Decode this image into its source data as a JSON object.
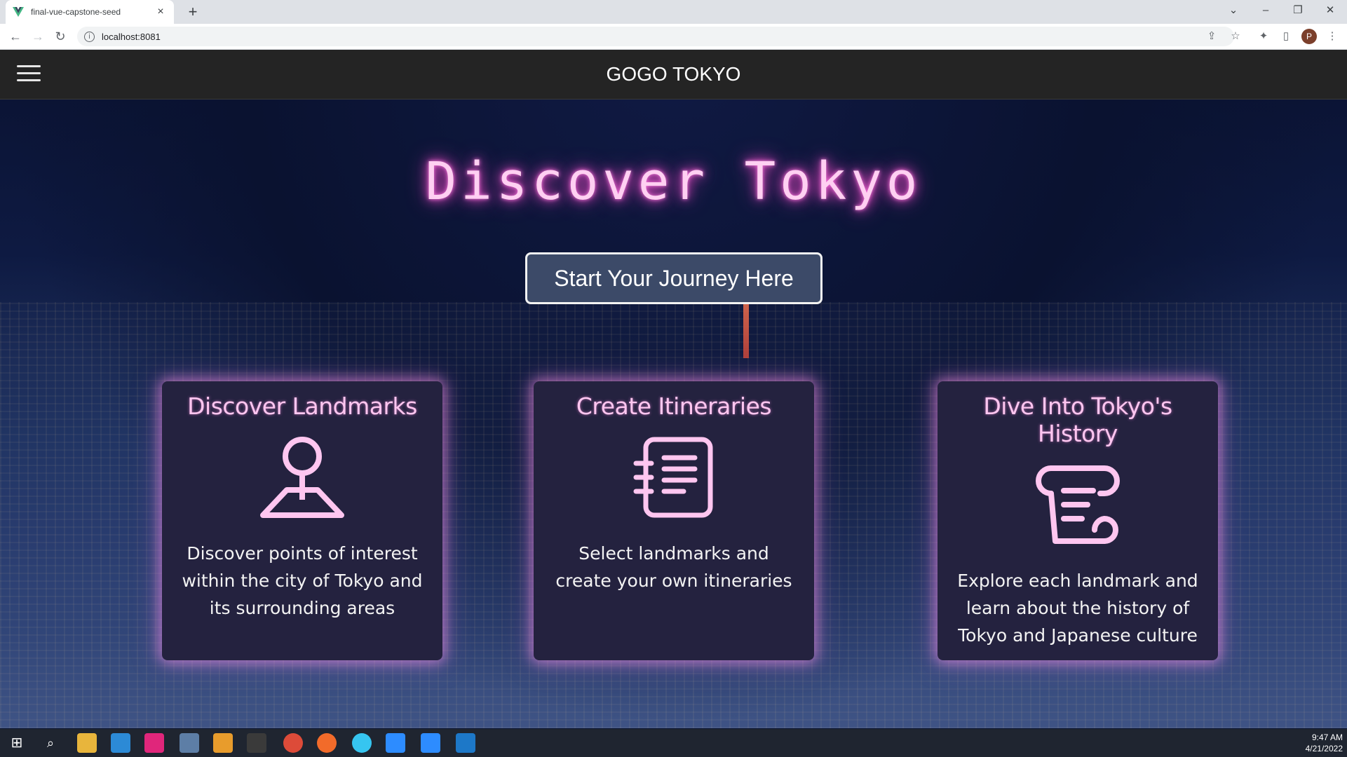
{
  "browser": {
    "tab_title": "final-vue-capstone-seed",
    "tab_close": "×",
    "new_tab": "+",
    "url": "localhost:8081",
    "profile_initial": "P"
  },
  "app": {
    "brand": "GOGO TOKYO",
    "hero_title": "Discover Tokyo",
    "cta_label": "Start Your Journey Here",
    "accent_color": "#ffc6f0",
    "card_bg": "#24223f"
  },
  "cards": [
    {
      "title": "Discover Landmarks",
      "icon": "map-pin-icon",
      "text": "Discover points of interest within the city of Tokyo and its surrounding areas"
    },
    {
      "title": "Create Itineraries",
      "icon": "itinerary-list-icon",
      "text": "Select landmarks and create your own itineraries"
    },
    {
      "title": "Dive Into Tokyo's History",
      "icon": "scroll-icon",
      "text": "Explore each landmark and learn about the history of Tokyo and Japanese culture"
    }
  ],
  "taskbar": {
    "time": "9:47 AM",
    "date": "4/21/2022"
  }
}
